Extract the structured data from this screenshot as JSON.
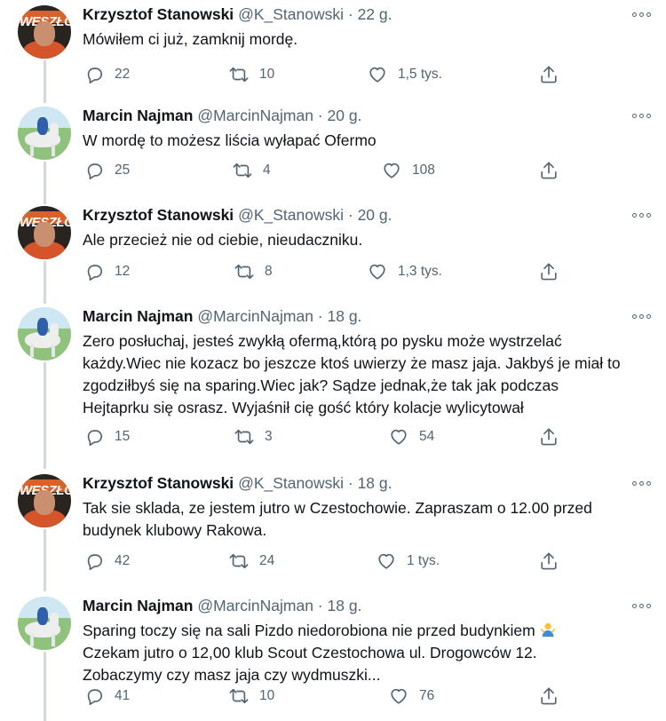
{
  "tweets": [
    {
      "avatar": "stanowski-avatar",
      "name": "Krzysztof Stanowski",
      "handle": "@K_Stanowski",
      "time": "22 g.",
      "lines": [
        "Mówiłem ci już, zamknij mordę."
      ],
      "replies": "22",
      "retweets": "10",
      "likes": "1,5 tys."
    },
    {
      "avatar": "najman-avatar",
      "name": "Marcin Najman",
      "handle": "@MarcinNajman",
      "time": "20 g.",
      "lines": [
        "W mordę to możesz liścia wyłapać Ofermo"
      ],
      "replies": "25",
      "retweets": "4",
      "likes": "108"
    },
    {
      "avatar": "stanowski-avatar",
      "name": "Krzysztof Stanowski",
      "handle": "@K_Stanowski",
      "time": "20 g.",
      "lines": [
        "Ale przecież nie od ciebie, nieudaczniku."
      ],
      "replies": "12",
      "retweets": "8",
      "likes": "1,3 tys."
    },
    {
      "avatar": "najman-avatar",
      "name": "Marcin Najman",
      "handle": "@MarcinNajman",
      "time": "18 g.",
      "lines": [
        "Zero posłuchaj, jesteś zwykłą ofermą,którą po pysku może wystrzelać",
        "każdy.Wiec nie kozacz bo jeszcze ktoś uwierzy że masz jaja. Jakbyś je miał to",
        "zgodziłbyś się na sparing.Wiec jak? Sądze jednak,że tak jak podczas",
        "Hejtaprku się osrasz. Wyjaśnił cię gość który kolacje wylicytował"
      ],
      "replies": "15",
      "retweets": "3",
      "likes": "54"
    },
    {
      "avatar": "stanowski-avatar",
      "name": "Krzysztof Stanowski",
      "handle": "@K_Stanowski",
      "time": "18 g.",
      "lines": [
        "Tak sie sklada, ze jestem jutro w Czestochowie. Zapraszam o 12.00 przed",
        "budynek klubowy Rakowa."
      ],
      "replies": "42",
      "retweets": "24",
      "likes": "1 tys."
    },
    {
      "avatar": "najman-avatar",
      "name": "Marcin Najman",
      "handle": "@MarcinNajman",
      "time": "18 g.",
      "lines": [
        "Sparing toczy się na sali Pizdo niedorobiona nie przed budynkiem",
        "Czekam jutro o 12,00 klub Scout Czestochowa ul. Drogowców 12.",
        "Zobaczymy czy masz jaja czy wydmuszki..."
      ],
      "replies": "41",
      "retweets": "10",
      "likes": "76"
    }
  ],
  "icons": {
    "reply": "reply-icon",
    "retweet": "retweet-icon",
    "like": "like-icon",
    "share": "share-icon",
    "more": "more-options-icon",
    "emoji": "person-shrugging-emoji-icon"
  },
  "colors": {
    "text": "#0f1419",
    "secondary": "#536471",
    "thread_line": "#cfd9de"
  }
}
